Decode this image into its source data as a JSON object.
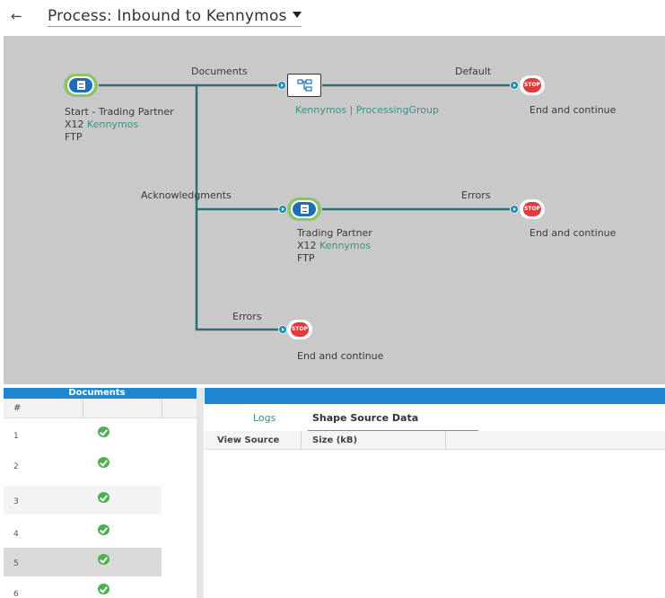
{
  "header": {
    "back_icon": "←",
    "title": "Process: Inbound to Kennymos"
  },
  "canvas": {
    "start": {
      "line1": "Start - Trading Partner",
      "line2_prefix": "X12",
      "line2_link": "Kennymos",
      "line3": "FTP"
    },
    "paths": {
      "documents": "Documents",
      "default": "Default",
      "acknowledgments": "Acknowledgments",
      "errors_top": "Errors",
      "errors_bottom": "Errors"
    },
    "process_group": "Kennymos | ProcessingGroup",
    "trading_partner": {
      "line1": "Trading Partner",
      "line2_prefix": "X12",
      "line2_link": "Kennymos",
      "line3": "FTP"
    },
    "stop_badge": "STOP",
    "end_labels": {
      "first": "End and continue",
      "second": "End and continue",
      "third": "End and continue"
    }
  },
  "documents_panel": {
    "header": "Documents",
    "col_number": "#",
    "rows": [
      "1",
      "2",
      "3",
      "4",
      "5",
      "6"
    ]
  },
  "right_panel": {
    "tabs": {
      "logs": "Logs",
      "shape_source": "Shape Source Data"
    },
    "columns": {
      "view_source": "View Source",
      "size": "Size (kB)"
    }
  },
  "colors": {
    "accent_blue": "#1d88d1",
    "path_teal": "#2e6f73",
    "link_teal": "#3d8f86",
    "stop_red": "#e03b3b",
    "check_green": "#4caf50",
    "start_ring": "#8dc46b"
  }
}
